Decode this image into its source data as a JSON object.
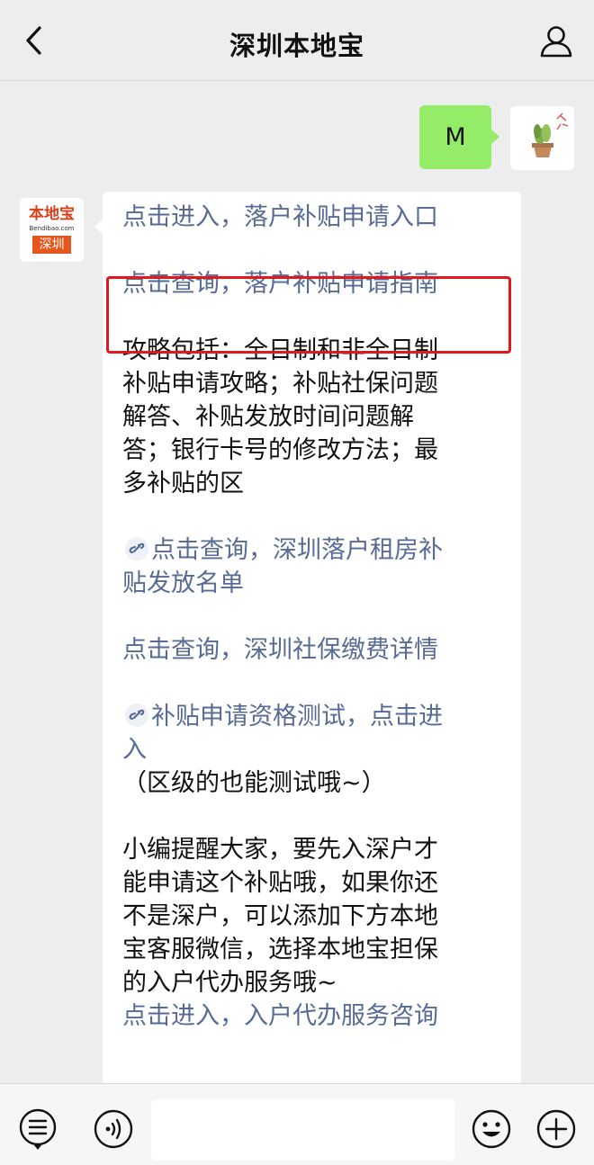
{
  "header": {
    "title": "深圳本地宝"
  },
  "outgoing": {
    "text": "M"
  },
  "bot": {
    "logo_top": "本地宝",
    "logo_mid": "Bendibao.com",
    "logo_bottom": "深圳"
  },
  "message": {
    "line1": "点击进入，落户补贴申请入口",
    "line2": "点击查询，落户补贴申请指南",
    "guide": [
      "攻略包括：全日制和非全日制",
      "补贴申请攻略；补贴社保问题",
      "解答、补贴发放时间问题解",
      "答；银行卡号的修改方法；最",
      "多补贴的区"
    ],
    "rent_link": [
      "点击查询，深圳落户租房补",
      "贴发放名单"
    ],
    "social_link": "点击查询，深圳社保缴费详情",
    "test_link": [
      "补贴申请资格测试，点击进",
      "入"
    ],
    "test_note": "（区级的也能测试哦~）",
    "reminder": [
      "小编提醒大家，要先入深户才",
      "能申请这个补贴哦，如果你还",
      "不是深户，可以添加下方本地",
      "宝客服微信，选择本地宝担保",
      "的入户代办服务哦~"
    ],
    "service_link": "点击进入，入户代办服务咨询"
  },
  "colors": {
    "link": "#576b95",
    "outgoing_bubble": "#95ec69",
    "highlight": "#e0191f",
    "background": "#ededed"
  },
  "icons": [
    "back-icon",
    "profile-icon",
    "menu-icon",
    "voice-icon",
    "emoji-icon",
    "plus-icon",
    "mini-program-icon"
  ]
}
